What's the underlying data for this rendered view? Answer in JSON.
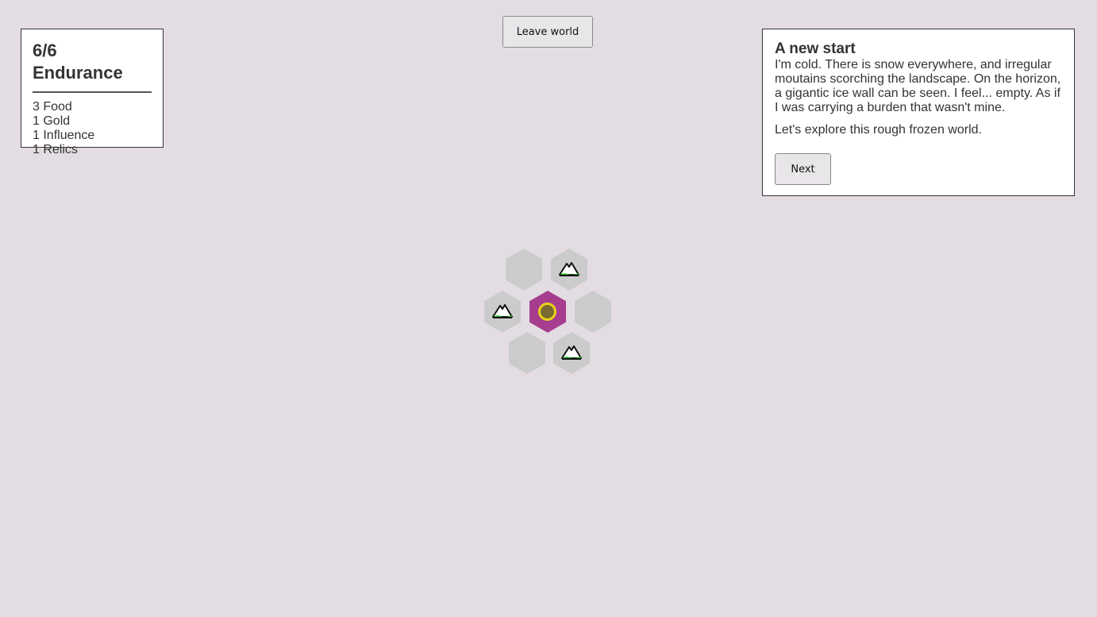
{
  "stats": {
    "title": "6/6 Endurance",
    "resources": [
      "3 Food",
      "1 Gold",
      "1 Influence",
      "1 Relics"
    ]
  },
  "header": {
    "leave_label": "Leave world"
  },
  "story": {
    "title": "A new start",
    "paragraph1": "I'm cold. There is snow everywhere, and irregular moutains scorching the landscape. On the horizon, a gigantic ice wall can be seen. I feel... empty. As if I was carrying a burden that wasn't mine.",
    "paragraph2": "Let's explore this rough frozen world.",
    "next_label": "Next"
  },
  "map": {
    "tiles": [
      {
        "id": "top-left",
        "terrain": "unknown"
      },
      {
        "id": "top-right",
        "terrain": "snowy-mountain"
      },
      {
        "id": "left",
        "terrain": "snowy-mountain"
      },
      {
        "id": "center",
        "terrain": "current-position"
      },
      {
        "id": "right",
        "terrain": "unknown"
      },
      {
        "id": "bottom-left",
        "terrain": "unknown"
      },
      {
        "id": "bottom-right",
        "terrain": "snowy-mountain"
      }
    ],
    "colors": {
      "unknown_tile": "#cbcbcb",
      "current_tile": "#a73d8f",
      "player_ring": "#e6d31a",
      "background": "#e3dde3"
    },
    "icons": {
      "mountain": "snowy-mountain-icon",
      "player": "player-token"
    }
  }
}
